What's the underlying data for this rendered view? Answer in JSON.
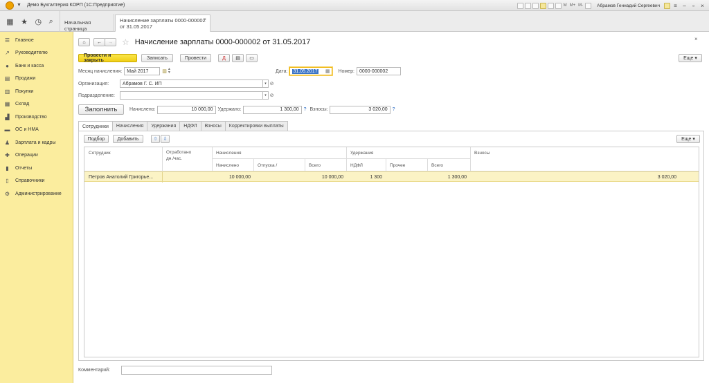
{
  "titlebar": {
    "title": "Демо Бухгалтерия КОРП  (1С:Предприятие)",
    "toolbar_tags": [
      "M",
      "M+",
      "M-"
    ],
    "user": "Абрамов Геннадий Сергеевич"
  },
  "nav": {
    "home_tab": "Начальная страница",
    "doc_tab_line1": "Начисление зарплаты 0000-000002",
    "doc_tab_line2": "от 31.05.2017"
  },
  "sidebar": {
    "items": [
      {
        "label": "Главное",
        "icon": "menu-icon"
      },
      {
        "label": "Руководителю",
        "icon": "trend-icon"
      },
      {
        "label": "Банк и касса",
        "icon": "coin-icon"
      },
      {
        "label": "Продажи",
        "icon": "shop-icon"
      },
      {
        "label": "Покупки",
        "icon": "cart-icon"
      },
      {
        "label": "Склад",
        "icon": "warehouse-icon"
      },
      {
        "label": "Производство",
        "icon": "factory-icon"
      },
      {
        "label": "ОС и НМА",
        "icon": "truck-icon"
      },
      {
        "label": "Зарплата и кадры",
        "icon": "person-icon"
      },
      {
        "label": "Операции",
        "icon": "operations-icon"
      },
      {
        "label": "Отчеты",
        "icon": "chart-icon"
      },
      {
        "label": "Справочники",
        "icon": "book-icon"
      },
      {
        "label": "Администрирование",
        "icon": "gear-icon"
      }
    ]
  },
  "doc": {
    "title": "Начисление зарплаты 0000-000002 от 31.05.2017",
    "buttons": {
      "post_close": "Провести и закрыть",
      "save": "Записать",
      "post": "Провести",
      "more": "Еще"
    },
    "month_label": "Месяц начисления:",
    "month_value": "Май 2017",
    "date_label": "Дата:",
    "date_value": "31.05.2017",
    "number_label": "Номер:",
    "number_value": "0000-000002",
    "org_label": "Организация:",
    "org_value": "Абрамов Г. С. ИП",
    "dept_label": "Подразделение:",
    "dept_value": "",
    "fill_button": "Заполнить",
    "accrued_label": "Начислено:",
    "accrued_value": "10 000,00",
    "withheld_label": "Удержано:",
    "withheld_value": "1 300,00",
    "contrib_label": "Взносы:",
    "contrib_value": "3 020,00",
    "question": "?"
  },
  "tabs": [
    "Сотрудники",
    "Начисления",
    "Удержания",
    "НДФЛ",
    "Взносы",
    "Корректировки выплаты"
  ],
  "table": {
    "pick_button": "Подбор",
    "add_button": "Добавить",
    "more_button": "Еще",
    "headers": {
      "employee": "Сотрудник",
      "worked_l1": "Отработано",
      "worked_l2": "дн./час.",
      "accruals": "Начисления",
      "accrued": "Начислено",
      "vacation": "Отпуска /",
      "total1": "Всего",
      "withholdings": "Удержания",
      "ndfl": "НДФЛ",
      "other": "Прочее",
      "total2": "Всего",
      "contributions": "Взносы"
    },
    "rows": [
      {
        "employee": "Петров Анатолий Григорье...",
        "worked": "",
        "accrued": "10 000,00",
        "vacation": "",
        "total1": "10 000,00",
        "ndfl": "1 300",
        "other": "",
        "total2": "1 300,00",
        "contributions": "3 020,00"
      }
    ]
  },
  "comment": {
    "label": "Комментарий:",
    "value": ""
  },
  "colors": {
    "sidebar_bg": "#fbed9e",
    "primary_button": "#f1ce17",
    "selected_row": "#fbf3c5",
    "active_tab_bar": "#4aaf4a"
  }
}
